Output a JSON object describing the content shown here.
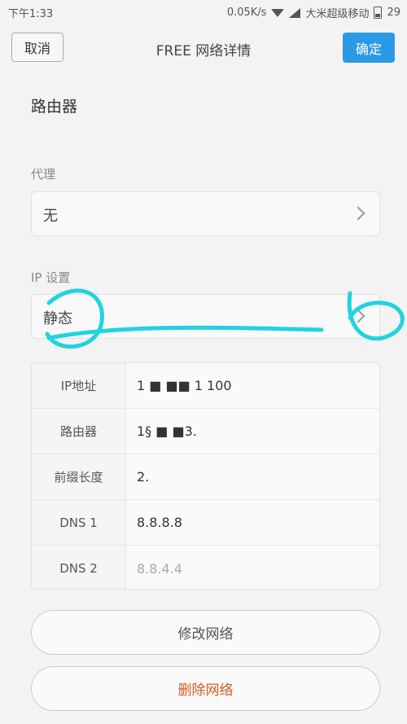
{
  "status_bar": {
    "time": "下午1:33",
    "speed": "0.05K/s",
    "carrier": "大米超级移动",
    "battery": "29"
  },
  "header": {
    "cancel_label": "取消",
    "title": "FREE 网络详情",
    "confirm_label": "确定"
  },
  "router_label": "路由器",
  "proxy": {
    "label": "代理",
    "value": "无"
  },
  "ip_settings": {
    "label": "IP 设置",
    "value": "静态"
  },
  "ip_table": {
    "rows": [
      {
        "key": "IP地址",
        "value": "1 ■ ■■ 1 100"
      },
      {
        "key": "路由器",
        "value": "1§ ■ ■3."
      },
      {
        "key": "前缀长度",
        "value": "2."
      },
      {
        "key": "DNS 1",
        "value": "8.8.8.8"
      },
      {
        "key": "DNS 2",
        "value": "8.8.4.4"
      }
    ]
  },
  "actions": {
    "modify_label": "修改网络",
    "delete_label": "删除网络"
  },
  "colors": {
    "accent": "#2a9ae6",
    "danger": "#d35a1f",
    "annotation": "#21d3e0"
  }
}
